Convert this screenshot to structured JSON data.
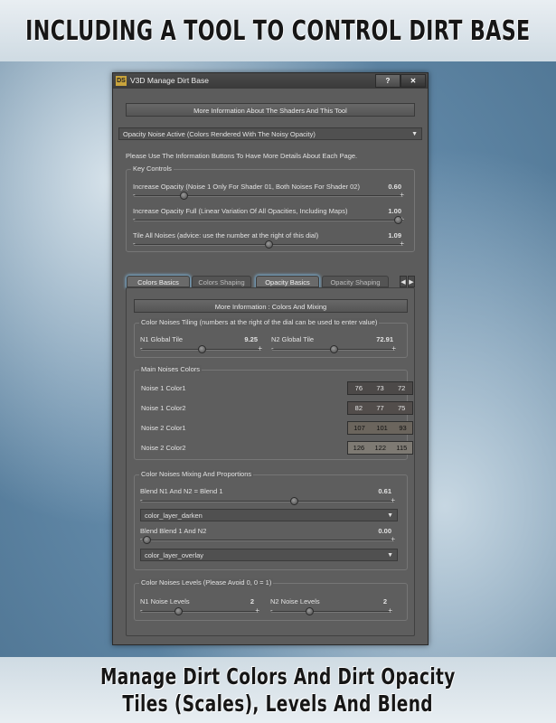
{
  "banners": {
    "top": "INCLUDING A TOOL TO CONTROL DIRT BASE",
    "bottom_line1": "Manage Dirt Colors And Dirt Opacity",
    "bottom_line2": "Tiles (Scales), Levels And Blend"
  },
  "window": {
    "logo": "DS",
    "title": "V3D Manage Dirt Base",
    "help_label": "?",
    "close_label": "✕"
  },
  "more_info_button": "More Information About The Shaders And This Tool",
  "mode_dropdown": "Opacity Noise Active (Colors Rendered With The Noisy Opacity)",
  "instructions": "Please Use The Information Buttons To Have More Details About Each Page.",
  "key_controls": {
    "title": "Key Controls",
    "sliders": [
      {
        "label": "Increase Opacity (Noise 1 Only For Shader 01, Both Noises For Shader 02)",
        "value": "0.60",
        "fraction": 0.17
      },
      {
        "label": "Increase Opacity Full (Linear Variation Of All Opacities, Including Maps)",
        "value": "1.00",
        "fraction": 1.0
      },
      {
        "label": "Tile All Noises (advice: use the number at the right of this dial)",
        "value": "1.09",
        "fraction": 0.5
      }
    ]
  },
  "tabs": [
    {
      "label": "Colors Basics",
      "active": true
    },
    {
      "label": "Colors Shaping",
      "active": false
    },
    {
      "label": "Opacity Basics",
      "active": true
    },
    {
      "label": "Opacity Shaping",
      "active": false
    }
  ],
  "tab_scroll": {
    "left": "◀",
    "right": "▶"
  },
  "panel": {
    "more_info_button": "More Information : Colors And Mixing",
    "tiling": {
      "title": "Color Noises Tiling (numbers at the right of the dial can be used to enter value)",
      "n1": {
        "label": "N1 Global Tile",
        "value": "9.25",
        "fraction": 0.5
      },
      "n2": {
        "label": "N2 Global Tile",
        "value": "72.91",
        "fraction": 0.5
      }
    },
    "main_colors": {
      "title": "Main Noises Colors",
      "rows": [
        {
          "label": "Noise 1 Color1",
          "rgb": [
            "76",
            "73",
            "72"
          ],
          "color": "#4c4948"
        },
        {
          "label": "Noise 1 Color2",
          "rgb": [
            "82",
            "77",
            "75"
          ],
          "color": "#524d4b"
        },
        {
          "label": "Noise 2 Color1",
          "rgb": [
            "107",
            "101",
            "93"
          ],
          "color": "#6b655d"
        },
        {
          "label": "Noise 2 Color2",
          "rgb": [
            "126",
            "122",
            "115"
          ],
          "color": "#7e7a73"
        }
      ]
    },
    "mixing": {
      "title": "Color Noises Mixing And Proportions",
      "blend1": {
        "label": "Blend N1 And N2 = Blend 1",
        "value": "0.61",
        "fraction": 0.61
      },
      "mode1": "color_layer_darken",
      "blend2": {
        "label": "Blend Blend 1 And N2",
        "value": "0.00",
        "fraction": 0.0
      },
      "mode2": "color_layer_overlay"
    },
    "levels": {
      "title": "Color Noises Levels (Please Avoid 0, 0 = 1)",
      "n1": {
        "label": "N1 Noise Levels",
        "value": "2",
        "fraction": 0.3
      },
      "n2": {
        "label": "N2 Noise Levels",
        "value": "2",
        "fraction": 0.3
      }
    }
  },
  "colors": {
    "window_bg": "#5c5c5c",
    "tab_glow": "#7fb7dd"
  }
}
